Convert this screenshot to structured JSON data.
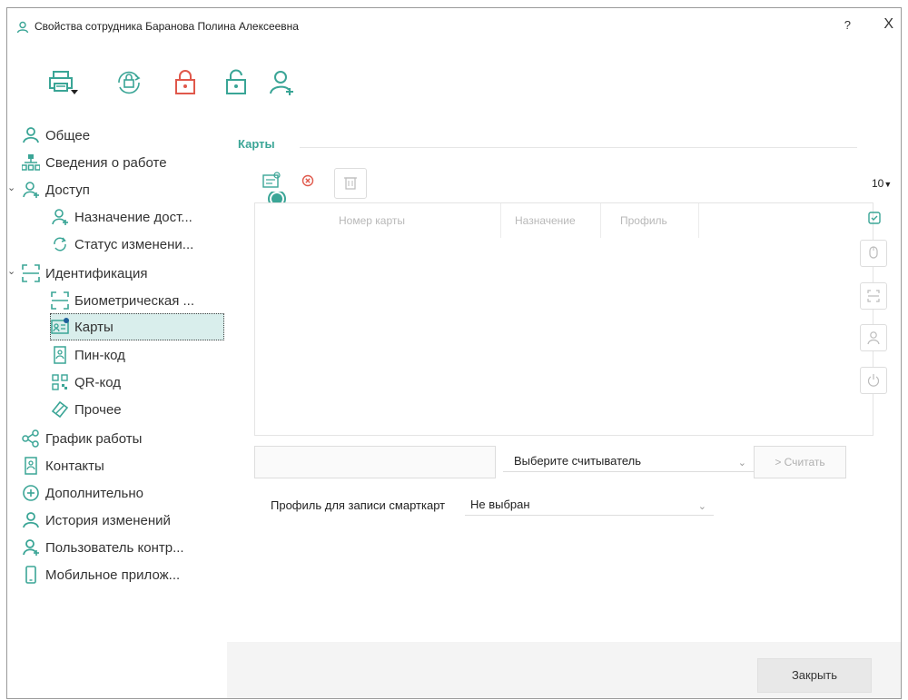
{
  "window": {
    "title": "Свойства сотрудника Баранова Полина  Алексеевна",
    "help": "?",
    "close": "X"
  },
  "toolbar": {
    "icons": [
      "printer-icon",
      "sync-icon",
      "lock-closed-icon",
      "lock-open-icon",
      "add-user-icon"
    ]
  },
  "sidebar": {
    "items": [
      {
        "label": "Общее"
      },
      {
        "label": "Сведения о работе"
      },
      {
        "label": "Доступ"
      },
      {
        "label": "Назначение дост..."
      },
      {
        "label": "Статус изменени..."
      },
      {
        "label": "Идентификация"
      },
      {
        "label": "Биометрическая ..."
      },
      {
        "label": "Карты"
      },
      {
        "label": "Пин-код"
      },
      {
        "label": "QR-код"
      },
      {
        "label": "Прочее"
      },
      {
        "label": "График работы"
      },
      {
        "label": "Контакты"
      },
      {
        "label": "Дополнительно"
      },
      {
        "label": "История изменений"
      },
      {
        "label": "Пользователь контр..."
      },
      {
        "label": "Мобильное прилож..."
      }
    ]
  },
  "content": {
    "section_title": "Карты",
    "page_size": "10",
    "columns": [
      "Номер карты",
      "Назначение",
      "Профиль"
    ],
    "reader_placeholder": "Выберите считыватель",
    "read_button": "> Считать",
    "smartcard_label": "Профиль для записи смарткарт",
    "smartcard_value": "Не выбран"
  },
  "footer": {
    "close_label": "Закрыть"
  },
  "colors": {
    "accent": "#3aa596",
    "red": "#e0584b",
    "selected_bg": "#d9eeec"
  }
}
